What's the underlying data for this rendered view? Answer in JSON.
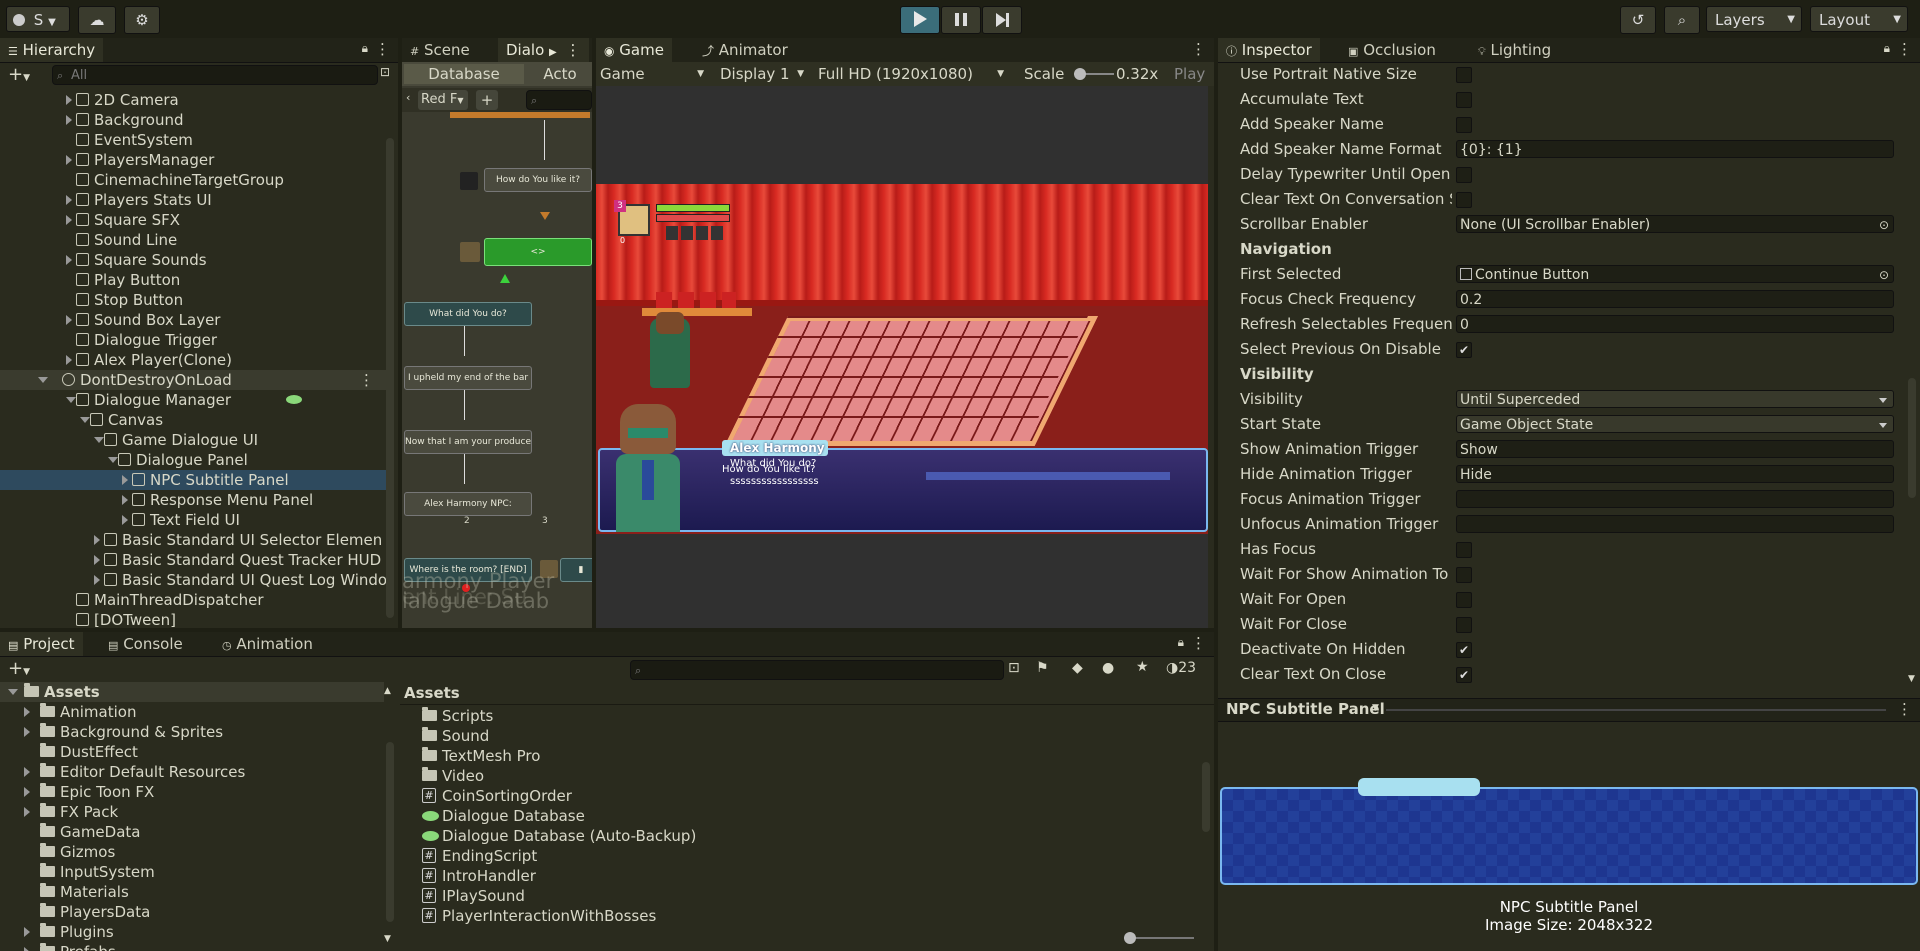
{
  "toolbar": {
    "account_label": "S",
    "layers_label": "Layers",
    "layout_label": "Layout"
  },
  "hierarchy": {
    "tab": "Hierarchy",
    "search_placeholder": "All",
    "items": [
      {
        "label": "2D Camera",
        "depth": 1,
        "arrow": "right",
        "icon": "cube"
      },
      {
        "label": "Background",
        "depth": 1,
        "arrow": "right",
        "icon": "cube"
      },
      {
        "label": "EventSystem",
        "depth": 1,
        "arrow": "none",
        "icon": "cube"
      },
      {
        "label": "PlayersManager",
        "depth": 1,
        "arrow": "right",
        "icon": "cube"
      },
      {
        "label": "CinemachineTargetGroup",
        "depth": 1,
        "arrow": "none",
        "icon": "cube"
      },
      {
        "label": "Players Stats UI",
        "depth": 1,
        "arrow": "right",
        "icon": "cube"
      },
      {
        "label": "Square SFX",
        "depth": 1,
        "arrow": "right",
        "icon": "cube"
      },
      {
        "label": "Sound Line",
        "depth": 1,
        "arrow": "none",
        "icon": "cube"
      },
      {
        "label": "Square Sounds",
        "depth": 1,
        "arrow": "right",
        "icon": "cube"
      },
      {
        "label": "Play Button",
        "depth": 1,
        "arrow": "none",
        "icon": "cube"
      },
      {
        "label": "Stop Button",
        "depth": 1,
        "arrow": "none",
        "icon": "cube"
      },
      {
        "label": "Sound Box Layer",
        "depth": 1,
        "arrow": "right",
        "icon": "cube"
      },
      {
        "label": "Dialogue Trigger",
        "depth": 1,
        "arrow": "none",
        "icon": "cube"
      },
      {
        "label": "Alex Player(Clone)",
        "depth": 1,
        "arrow": "right",
        "icon": "cube"
      },
      {
        "label": "DontDestroyOnLoad",
        "depth": 0,
        "arrow": "down",
        "icon": "scene",
        "sel": "sel2"
      },
      {
        "label": "Dialogue Manager",
        "depth": 1,
        "arrow": "down",
        "icon": "cube"
      },
      {
        "label": "Canvas",
        "depth": 2,
        "arrow": "down",
        "icon": "cube"
      },
      {
        "label": "Game Dialogue UI",
        "depth": 3,
        "arrow": "down",
        "icon": "cube"
      },
      {
        "label": "Dialogue Panel",
        "depth": 4,
        "arrow": "down",
        "icon": "cube"
      },
      {
        "label": "NPC Subtitle Panel",
        "depth": 5,
        "arrow": "right",
        "icon": "cube",
        "sel": "sel"
      },
      {
        "label": "Response Menu Panel",
        "depth": 5,
        "arrow": "right",
        "icon": "cube"
      },
      {
        "label": "Text Field UI",
        "depth": 5,
        "arrow": "right",
        "icon": "cube"
      },
      {
        "label": "Basic Standard UI Selector Elemen",
        "depth": 3,
        "arrow": "right",
        "icon": "cube"
      },
      {
        "label": "Basic Standard Quest Tracker HUD",
        "depth": 3,
        "arrow": "right",
        "icon": "cube"
      },
      {
        "label": "Basic Standard UI Quest Log Windo",
        "depth": 3,
        "arrow": "right",
        "icon": "cube"
      },
      {
        "label": "MainThreadDispatcher",
        "depth": 1,
        "arrow": "none",
        "icon": "cube"
      },
      {
        "label": "[DOTween]",
        "depth": 1,
        "arrow": "none",
        "icon": "cube"
      }
    ]
  },
  "dialogue_editor": {
    "tab_scene": "Scene",
    "tab_dialogue": "Dialo",
    "sub_database": "Database",
    "sub_actors": "Acto",
    "filter": "Red F",
    "nodes": [
      {
        "text": "How do You like it?"
      },
      {
        "text": "<>"
      },
      {
        "text": "What did You do?"
      },
      {
        "text": "I upheld my end of the bar"
      },
      {
        "text": "Now that I am your produce"
      },
      {
        "text": "Alex Harmony NPC:"
      },
      {
        "text": "Where is the room? [END]"
      }
    ],
    "num_2": "2",
    "num_3": "3",
    "overlay_1": "armony Player",
    "overlay_2": "ialogue Datab",
    "overlay_3": "ent Line: Su"
  },
  "game": {
    "tab_game": "Game",
    "tab_animator": "Animator",
    "mode": "Game",
    "display": "Display 1",
    "resolution": "Full HD (1920x1080)",
    "scale_label": "Scale",
    "scale_value": "0.32x",
    "play_label": "Play",
    "badge_num": "3",
    "small_text": "0",
    "speaker": "Alex Harmony",
    "line1": "How do You like it?",
    "line2": "What did You do?",
    "line3": "sssssssssssssssss"
  },
  "inspector": {
    "tabs": [
      "Inspector",
      "Occlusion",
      "Lighting"
    ],
    "rows": [
      {
        "type": "check",
        "label": "Use Portrait Native Size",
        "checked": false
      },
      {
        "type": "check",
        "label": "Accumulate Text",
        "checked": false
      },
      {
        "type": "check",
        "label": "Add Speaker Name",
        "checked": false
      },
      {
        "type": "text",
        "label": "Add Speaker Name Format",
        "value": "{0}: {1}"
      },
      {
        "type": "check",
        "label": "Delay Typewriter Until Open",
        "checked": false
      },
      {
        "type": "check",
        "label": "Clear Text On Conversation Start",
        "checked": false
      },
      {
        "type": "obj",
        "label": "Scrollbar Enabler",
        "value": "None (UI Scrollbar Enabler)"
      },
      {
        "type": "head",
        "label": "Navigation"
      },
      {
        "type": "obj",
        "label": "First Selected",
        "value": "Continue Button"
      },
      {
        "type": "text",
        "label": "Focus Check Frequency",
        "value": "0.2"
      },
      {
        "type": "text",
        "label": "Refresh Selectables Frequency",
        "value": "0"
      },
      {
        "type": "check",
        "label": "Select Previous On Disable",
        "checked": true
      },
      {
        "type": "head",
        "label": "Visibility"
      },
      {
        "type": "dd",
        "label": "Visibility",
        "value": "Until Superceded"
      },
      {
        "type": "dd",
        "label": "Start State",
        "value": "Game Object State"
      },
      {
        "type": "text",
        "label": "Show Animation Trigger",
        "value": "Show"
      },
      {
        "type": "text",
        "label": "Hide Animation Trigger",
        "value": "Hide"
      },
      {
        "type": "text",
        "label": "Focus Animation Trigger",
        "value": ""
      },
      {
        "type": "text",
        "label": "Unfocus Animation Trigger",
        "value": ""
      },
      {
        "type": "check",
        "label": "Has Focus",
        "checked": false
      },
      {
        "type": "check",
        "label": "Wait For Show Animation To Set Ope",
        "checked": false
      },
      {
        "type": "check",
        "label": "Wait For Open",
        "checked": false
      },
      {
        "type": "check",
        "label": "Wait For Close",
        "checked": false
      },
      {
        "type": "check",
        "label": "Deactivate On Hidden",
        "checked": true
      },
      {
        "type": "check",
        "label": "Clear Text On Close",
        "checked": true
      }
    ],
    "preview_title": "NPC Subtitle Panel",
    "preview_name": "NPC Subtitle Panel",
    "preview_size": "Image Size: 2048x322"
  },
  "project": {
    "tabs": [
      "Project",
      "Console",
      "Animation"
    ],
    "hidden_count": "23",
    "tree_root": "Assets",
    "tree": [
      {
        "label": "Animation",
        "arrow": true
      },
      {
        "label": "Background & Sprites",
        "arrow": true
      },
      {
        "label": "DustEffect",
        "arrow": false
      },
      {
        "label": "Editor Default Resources",
        "arrow": true
      },
      {
        "label": "Epic Toon FX",
        "arrow": true
      },
      {
        "label": "FX Pack",
        "arrow": true
      },
      {
        "label": "GameData",
        "arrow": false
      },
      {
        "label": "Gizmos",
        "arrow": false
      },
      {
        "label": "InputSystem",
        "arrow": false
      },
      {
        "label": "Materials",
        "arrow": false
      },
      {
        "label": "PlayersData",
        "arrow": false
      },
      {
        "label": "Plugins",
        "arrow": true
      },
      {
        "label": "Prefabs",
        "arrow": true
      }
    ],
    "breadcrumb": "Assets",
    "files": [
      {
        "label": "Scripts",
        "icon": "folder"
      },
      {
        "label": "Sound",
        "icon": "folder"
      },
      {
        "label": "TextMesh Pro",
        "icon": "folder"
      },
      {
        "label": "Video",
        "icon": "folder"
      },
      {
        "label": "CoinSortingOrder",
        "icon": "script"
      },
      {
        "label": "Dialogue Database",
        "icon": "db"
      },
      {
        "label": "Dialogue Database (Auto-Backup)",
        "icon": "db"
      },
      {
        "label": "EndingScript",
        "icon": "script"
      },
      {
        "label": "IntroHandler",
        "icon": "script"
      },
      {
        "label": "IPlaySound",
        "icon": "script"
      },
      {
        "label": "PlayerInteractionWithBosses",
        "icon": "script"
      }
    ]
  },
  "colors": {
    "accent_blue": "#4a9be0",
    "curtain_red": "#c3201f",
    "selection": "#2e4a5e"
  }
}
